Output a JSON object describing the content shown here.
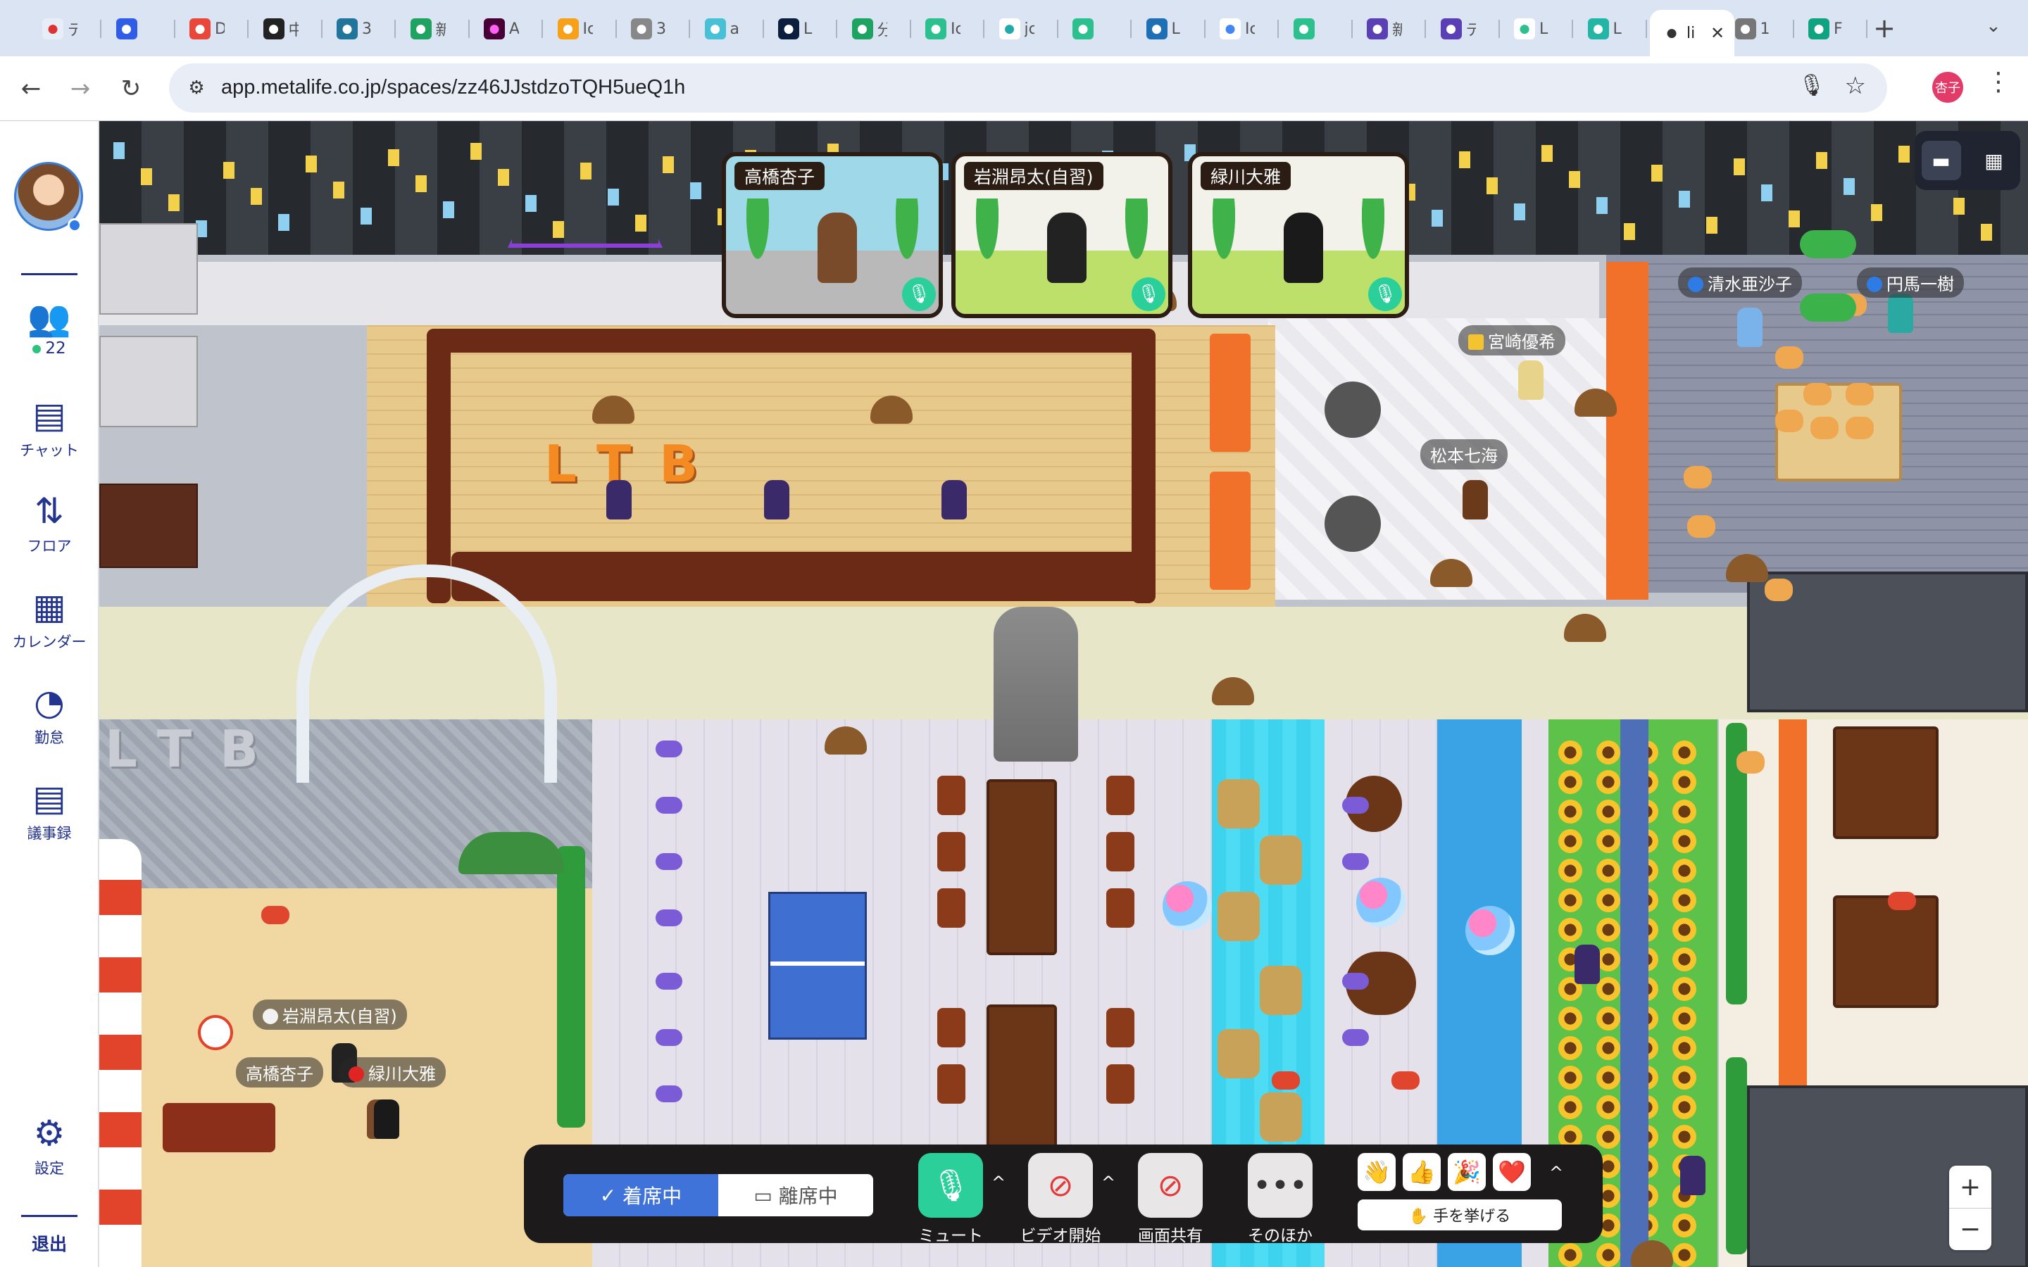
{
  "browser": {
    "tabs": [
      {
        "label": "テ",
        "fav": "#e8eef8",
        "fg": "#d33",
        "icon": "calendar-icon"
      },
      {
        "label": "",
        "fav": "#2f5de8",
        "fg": "#fff",
        "icon": "slash-icon"
      },
      {
        "label": "D",
        "fav": "#e9473a",
        "fg": "#fff",
        "icon": "sushi-icon"
      },
      {
        "label": "中",
        "fav": "#222",
        "fg": "#fff",
        "icon": "codepen-icon"
      },
      {
        "label": "3",
        "fav": "#21759b",
        "fg": "#fff",
        "icon": "wordpress-icon"
      },
      {
        "label": "新",
        "fav": "#1ea362",
        "fg": "#fff",
        "icon": "sheets-plus-icon"
      },
      {
        "label": "A",
        "fav": "#470137",
        "fg": "#ff61f6",
        "icon": "xd-icon"
      },
      {
        "label": "Ic",
        "fav": "#f7a11a",
        "fg": "#fff",
        "icon": "fma-icon"
      },
      {
        "label": "3",
        "fav": "#888",
        "fg": "#fff",
        "icon": "github-icon"
      },
      {
        "label": "a",
        "fav": "#48c0d6",
        "fg": "#fff",
        "icon": "bird-icon"
      },
      {
        "label": "L",
        "fav": "#0b1e3d",
        "fg": "#fff",
        "icon": "b-icon"
      },
      {
        "label": "分",
        "fav": "#1ea362",
        "fg": "#fff",
        "icon": "sheets-icon"
      },
      {
        "label": "Ic",
        "fav": "#2bc08d",
        "fg": "#fff",
        "icon": "c-icon"
      },
      {
        "label": "jc",
        "fav": "#fff",
        "fg": "#2aa",
        "icon": "y-icon"
      },
      {
        "label": "",
        "fav": "#2bc08d",
        "fg": "#fff",
        "icon": "c-icon"
      },
      {
        "label": "L",
        "fav": "#1f6fb5",
        "fg": "#fff",
        "icon": "wk-icon"
      },
      {
        "label": "Ic",
        "fav": "#fff",
        "fg": "#4285f4",
        "icon": "google-icon"
      },
      {
        "label": "",
        "fav": "#2bc08d",
        "fg": "#fff",
        "icon": "c-icon"
      },
      {
        "label": "新",
        "fav": "#5b3fb5",
        "fg": "#fff",
        "icon": "list-icon"
      },
      {
        "label": "テ",
        "fav": "#5b3fb5",
        "fg": "#fff",
        "icon": "list-icon"
      },
      {
        "label": "L",
        "fav": "#fff",
        "fg": "#2bc08d",
        "icon": "metalife-icon"
      },
      {
        "label": "L",
        "fav": "#23b6a5",
        "fg": "#fff",
        "icon": "s-icon"
      },
      {
        "label": "li",
        "fav": "#fff",
        "fg": "#333",
        "icon": "page-icon",
        "active": true
      },
      {
        "label": "1",
        "fav": "#777",
        "fg": "#fff",
        "icon": "globe-icon"
      },
      {
        "label": "F",
        "fav": "#10a37f",
        "fg": "#fff",
        "icon": "openai-icon"
      }
    ],
    "close_glyph": "✕",
    "new_tab": "+",
    "tab_menu": "⌄",
    "url": "app.metalife.co.jp/spaces/zz46JJstdzoTQH5ueQ1h",
    "profile": "杏子"
  },
  "sidebar": {
    "members_count": "22",
    "items": [
      {
        "label": "チャット",
        "icon": "chat-icon",
        "glyph": "▤"
      },
      {
        "label": "フロア",
        "icon": "floor-arrows-icon",
        "glyph": "⇅"
      },
      {
        "label": "カレンダー",
        "icon": "calendar-icon",
        "glyph": "▦"
      },
      {
        "label": "勤怠",
        "icon": "alarm-clock-icon",
        "glyph": "◔"
      },
      {
        "label": "議事録",
        "icon": "document-icon",
        "glyph": "▤"
      }
    ],
    "settings": "設定",
    "exit": "退出"
  },
  "video_cards": [
    {
      "name": "高橋杏子",
      "bg": "#9fd9e9",
      "floor": "#b9b9b9",
      "char": "#7a4b2a"
    },
    {
      "name": "岩淵昂太(自習)",
      "bg": "#f2f2ea",
      "floor": "#bde06a",
      "char": "#222"
    },
    {
      "name": "緑川大雅",
      "bg": "#f2f2ea",
      "floor": "#bde06a",
      "char": "#1a1a1a"
    }
  ],
  "map": {
    "logo_letters": "LTB",
    "name_tags": [
      {
        "name": "清水亜沙子",
        "status": "#2f7be6"
      },
      {
        "name": "円馬一樹",
        "status": "#2f7be6"
      },
      {
        "name": "宮崎優希",
        "status": "#f4c430"
      },
      {
        "name": "松本七海",
        "status": ""
      },
      {
        "name": "岩淵昂太(自習)",
        "status": "#f2f2f2"
      },
      {
        "name": "高橋杏子",
        "status": ""
      },
      {
        "name": "緑川大雅",
        "status": "#e02424"
      }
    ]
  },
  "controls": {
    "present": "着席中",
    "away": "離席中",
    "mute": "ミュート",
    "video": "ビデオ開始",
    "share": "画面共有",
    "more": "そのほか",
    "reactions": [
      "👋",
      "👍",
      "🎉",
      "❤️"
    ],
    "raise_hand": "✋ 手を挙げる",
    "zoom_in": "+",
    "zoom_out": "−"
  },
  "colors": {
    "accent": "#3f73d9",
    "nav": "#1e2e8a",
    "mic_on": "#2bcf9a"
  }
}
